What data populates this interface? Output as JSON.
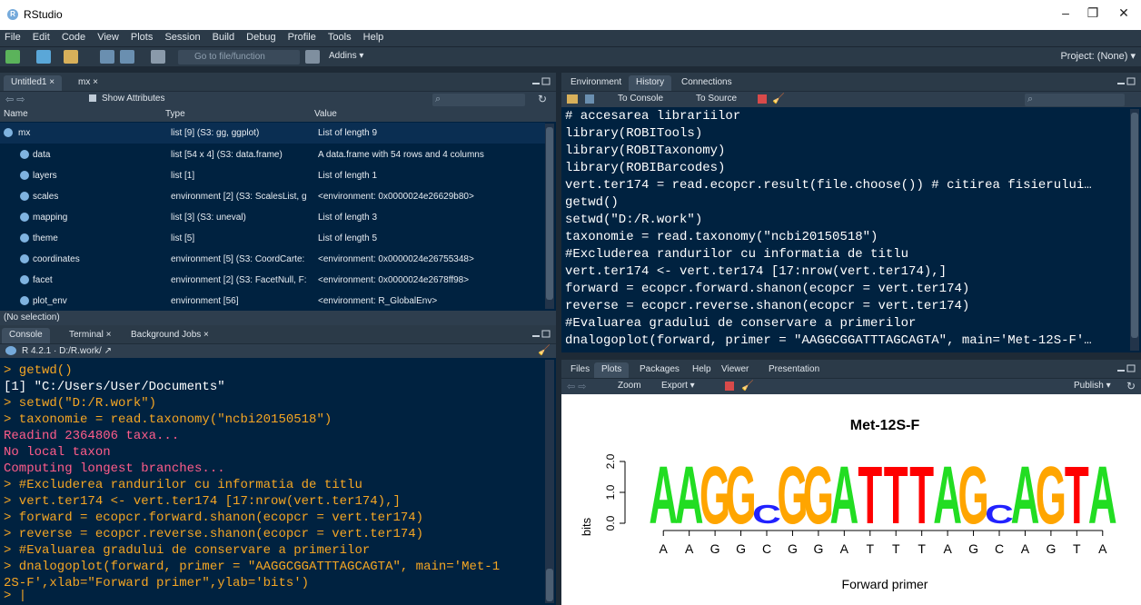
{
  "window": {
    "title": "RStudio",
    "minimize": "–",
    "maximize": "❐",
    "close": "✕"
  },
  "menu": [
    "File",
    "Edit",
    "Code",
    "View",
    "Plots",
    "Session",
    "Build",
    "Debug",
    "Profile",
    "Tools",
    "Help"
  ],
  "toolbar": {
    "goto_placeholder": "Go to file/function",
    "addins": "Addins ▾",
    "project": "Project: (None) ▾"
  },
  "source": {
    "tabs": [
      "Untitled1 ×",
      "mx ×"
    ],
    "show_attributes": "Show Attributes",
    "headers": [
      "Name",
      "Type",
      "Value"
    ],
    "rows": [
      {
        "name": "mx",
        "type": "list [9] (S3: gg, ggplot)",
        "value": "List of length 9"
      },
      {
        "name": "data",
        "type": "list [54 x 4] (S3: data.frame)",
        "value": "A data.frame with 54 rows and 4 columns"
      },
      {
        "name": "layers",
        "type": "list [1]",
        "value": "List of length 1"
      },
      {
        "name": "scales",
        "type": "environment [2] (S3: ScalesList, g",
        "value": "<environment: 0x0000024e26629b80>"
      },
      {
        "name": "mapping",
        "type": "list [3] (S3: uneval)",
        "value": "List of length 3"
      },
      {
        "name": "theme",
        "type": "list [5]",
        "value": "List of length 5"
      },
      {
        "name": "coordinates",
        "type": "environment [5] (S3: CoordCarte:",
        "value": "<environment: 0x0000024e26755348>"
      },
      {
        "name": "facet",
        "type": "environment [2] (S3: FacetNull, F:",
        "value": "<environment: 0x0000024e2678ff98>"
      },
      {
        "name": "plot_env",
        "type": "environment [56]",
        "value": "<environment: R_GlobalEnv>"
      }
    ],
    "status": "(No selection)"
  },
  "history": {
    "tabs": [
      "Environment",
      "History",
      "Connections"
    ],
    "to_console": "To Console",
    "to_source": "To Source",
    "lines": [
      "# accesarea librariilor",
      "library(ROBITools)",
      "library(ROBITaxonomy)",
      "library(ROBIBarcodes)",
      "vert.ter174 = read.ecopcr.result(file.choose()) # citirea fisierului…",
      "getwd()",
      "setwd(\"D:/R.work\")",
      "taxonomie = read.taxonomy(\"ncbi20150518\")",
      "#Excluderea randurilor cu informatia de titlu",
      "vert.ter174 <- vert.ter174 [17:nrow(vert.ter174),]",
      "forward = ecopcr.forward.shanon(ecopcr = vert.ter174)",
      "reverse = ecopcr.reverse.shanon(ecopcr = vert.ter174)",
      "#Evaluarea gradului de conservare a primerilor",
      "dnalogoplot(forward, primer = \"AAGGCGGATTTAGCAGTA\", main='Met-12S-F'…"
    ]
  },
  "console": {
    "tabs": [
      "Console",
      "Terminal ×",
      "Background Jobs ×"
    ],
    "version": "R 4.2.1 · D:/R.work/ ↗",
    "lines": [
      {
        "text": "> getwd()",
        "color": "#f5a623"
      },
      {
        "text": "[1] \"C:/Users/User/Documents\"",
        "color": "#ffffff"
      },
      {
        "text": "> setwd(\"D:/R.work\")",
        "color": "#f5a623"
      },
      {
        "text": "> taxonomie = read.taxonomy(\"ncbi20150518\")",
        "color": "#f5a623"
      },
      {
        "text": "Readind 2364806 taxa...",
        "color": "#ff5c8a"
      },
      {
        "text": "No local taxon",
        "color": "#ff5c8a"
      },
      {
        "text": "Computing longest branches...",
        "color": "#ff5c8a"
      },
      {
        "text": "> #Excluderea randurilor cu informatia de titlu",
        "color": "#f5a623"
      },
      {
        "text": "> vert.ter174 <- vert.ter174 [17:nrow(vert.ter174),]",
        "color": "#f5a623"
      },
      {
        "text": "> forward = ecopcr.forward.shanon(ecopcr = vert.ter174)",
        "color": "#f5a623"
      },
      {
        "text": "> reverse = ecopcr.reverse.shanon(ecopcr = vert.ter174)",
        "color": "#f5a623"
      },
      {
        "text": "> #Evaluarea gradului de conservare a primerilor",
        "color": "#f5a623"
      },
      {
        "text": "> dnalogoplot(forward, primer = \"AAGGCGGATTTAGCAGTA\", main='Met-1",
        "color": "#f5a623"
      },
      {
        "text": "2S-F',xlab=\"Forward primer\",ylab='bits')",
        "color": "#f5a623"
      },
      {
        "text": "> |",
        "color": "#f5a623"
      }
    ]
  },
  "plots": {
    "tabs": [
      "Files",
      "Plots",
      "Packages",
      "Help",
      "Viewer",
      "Presentation"
    ],
    "zoom": "Zoom",
    "export": "Export ▾",
    "publish": "Publish ▾"
  },
  "chart_data": {
    "type": "sequence-logo",
    "title": "Met-12S-F",
    "xlabel": "Forward primer",
    "ylabel": "bits",
    "ylim": [
      0,
      2
    ],
    "yticks": [
      "0.0",
      "1.0",
      "2.0"
    ],
    "primer": [
      "A",
      "A",
      "G",
      "G",
      "C",
      "G",
      "G",
      "A",
      "T",
      "T",
      "T",
      "A",
      "G",
      "C",
      "A",
      "G",
      "T",
      "A"
    ],
    "logo": [
      "A",
      "A",
      "G",
      "G",
      "C",
      "G",
      "G",
      "A",
      "T",
      "T",
      "T",
      "A",
      "G",
      "C",
      "A",
      "G",
      "T",
      "A"
    ],
    "heights": [
      1.9,
      1.9,
      1.9,
      1.9,
      0.6,
      1.9,
      1.9,
      1.9,
      1.9,
      1.9,
      1.9,
      1.9,
      1.9,
      0.6,
      1.9,
      1.9,
      1.9,
      1.9
    ],
    "colors": {
      "A": "#22dd22",
      "C": "#2222ff",
      "G": "#ffa500",
      "T": "#ff0000"
    }
  }
}
